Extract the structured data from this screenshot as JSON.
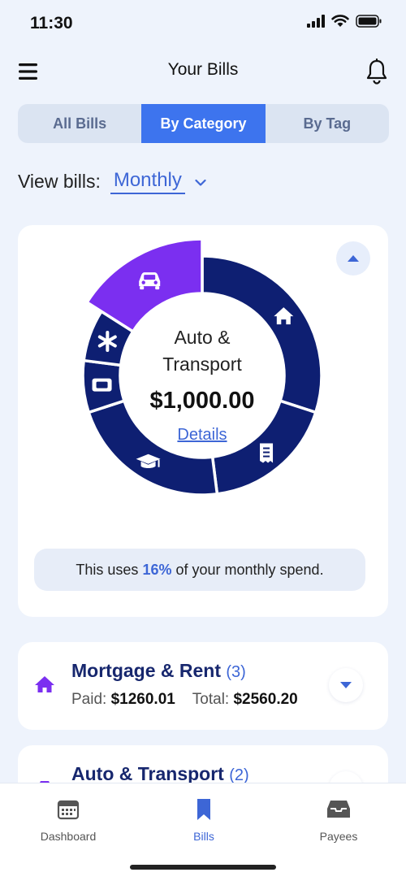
{
  "status": {
    "time": "11:30"
  },
  "header": {
    "title": "Your Bills"
  },
  "segments": [
    {
      "label": "All Bills",
      "active": false
    },
    {
      "label": "By Category",
      "active": true
    },
    {
      "label": "By Tag",
      "active": false
    }
  ],
  "view": {
    "label": "View bills:",
    "value": "Monthly"
  },
  "chart": {
    "selected_name": "Auto &\nTransport",
    "selected_name_line1": "Auto &",
    "selected_name_line2": "Transport",
    "selected_amount": "$1,000.00",
    "details_label": "Details",
    "spend_prefix": "This uses",
    "spend_pct": "16%",
    "spend_suffix": "of your monthly spend."
  },
  "chart_data": {
    "type": "pie",
    "slices": [
      {
        "icon": "home-icon",
        "share": 0.3,
        "color": "#0e1f72"
      },
      {
        "icon": "receipt-icon",
        "share": 0.18,
        "color": "#0e1f72"
      },
      {
        "icon": "graduation-cap-icon",
        "share": 0.22,
        "color": "#0e1f72"
      },
      {
        "icon": "ticket-icon",
        "share": 0.07,
        "color": "#0e1f72"
      },
      {
        "icon": "asterisk-icon",
        "share": 0.07,
        "color": "#0e1f72"
      },
      {
        "icon": "car-icon",
        "share": 0.16,
        "color": "#7b2ff0",
        "selected": true
      }
    ]
  },
  "categories": [
    {
      "title": "Mortgage & Rent",
      "count": "(3)",
      "paid_label": "Paid:",
      "paid": "$1260.01",
      "total_label": "Total:",
      "total": "$2560.20",
      "icon": "home-icon"
    },
    {
      "title": "Auto & Transport",
      "count": "(2)",
      "icon": "car-icon"
    }
  ],
  "tabs": [
    {
      "label": "Dashboard",
      "icon": "calendar-icon"
    },
    {
      "label": "Bills",
      "icon": "bookmark-icon",
      "active": true
    },
    {
      "label": "Payees",
      "icon": "inbox-icon"
    }
  ],
  "colors": {
    "accent": "#3d66d6",
    "navy": "#0e1f72",
    "purple": "#7b2ff0",
    "background": "#eef3fc"
  }
}
